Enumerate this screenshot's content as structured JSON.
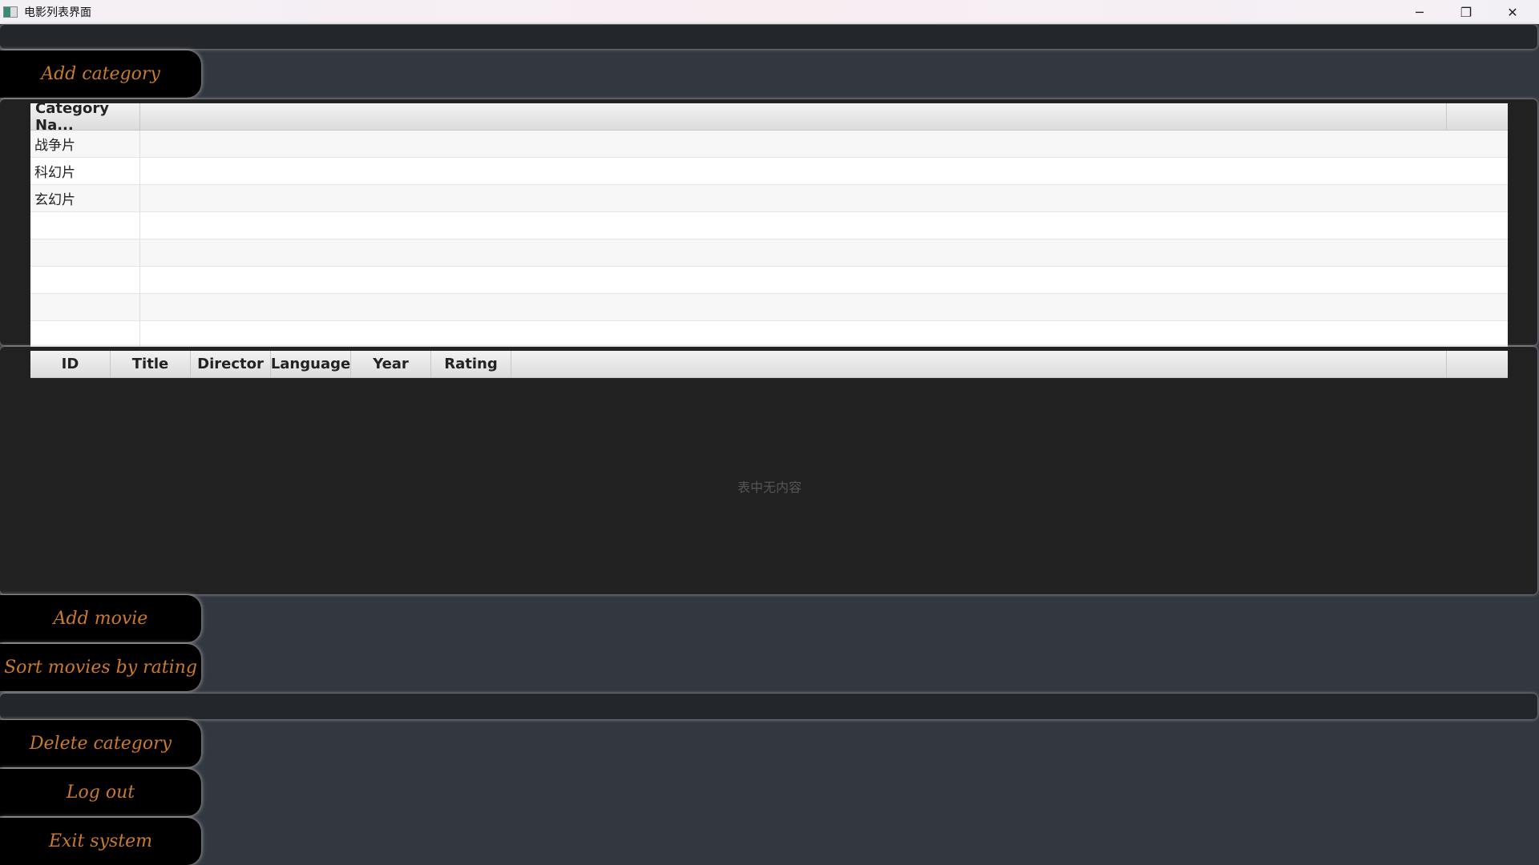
{
  "window": {
    "title": "电影列表界面",
    "minimize": "─",
    "restore": "❐",
    "close": "✕"
  },
  "buttons": {
    "add_category": "Add category",
    "add_movie": "Add movie",
    "sort_movies": "Sort movies by rating",
    "delete_category": "Delete category",
    "log_out": "Log out",
    "exit_system": "Exit system"
  },
  "category_table": {
    "columns": [
      "Category Na..."
    ],
    "rows": [
      "战争片",
      "科幻片",
      "玄幻片",
      "",
      "",
      "",
      "",
      ""
    ]
  },
  "movie_table": {
    "columns": [
      "ID",
      "Title",
      "Director",
      "Language",
      "Year",
      "Rating"
    ],
    "empty_text": "表中无内容"
  }
}
